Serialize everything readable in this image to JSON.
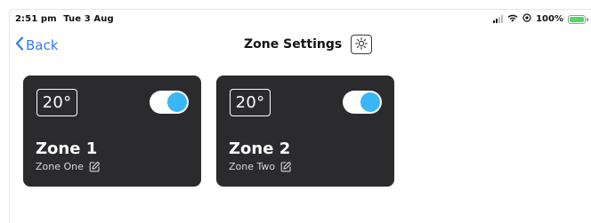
{
  "status_bar": {
    "time": "2:51 pm",
    "date": "Tue 3 Aug",
    "battery_percent": "100%",
    "battery_level": 1.0,
    "icons": [
      "signal-icon",
      "wifi-icon",
      "location-icon",
      "battery-icon"
    ]
  },
  "nav": {
    "back_label": "Back",
    "title": "Zone Settings",
    "action_icon": "brightness-icon"
  },
  "colors": {
    "accent": "#2f7bf5",
    "card_background": "#2b2b2e",
    "toggle_on": "#39b6f5",
    "battery": "#4cd964"
  },
  "zones": [
    {
      "temperature": "20°",
      "name": "Zone 1",
      "description": "Zone One",
      "enabled": true
    },
    {
      "temperature": "20°",
      "name": "Zone 2",
      "description": "Zone Two",
      "enabled": true
    }
  ]
}
